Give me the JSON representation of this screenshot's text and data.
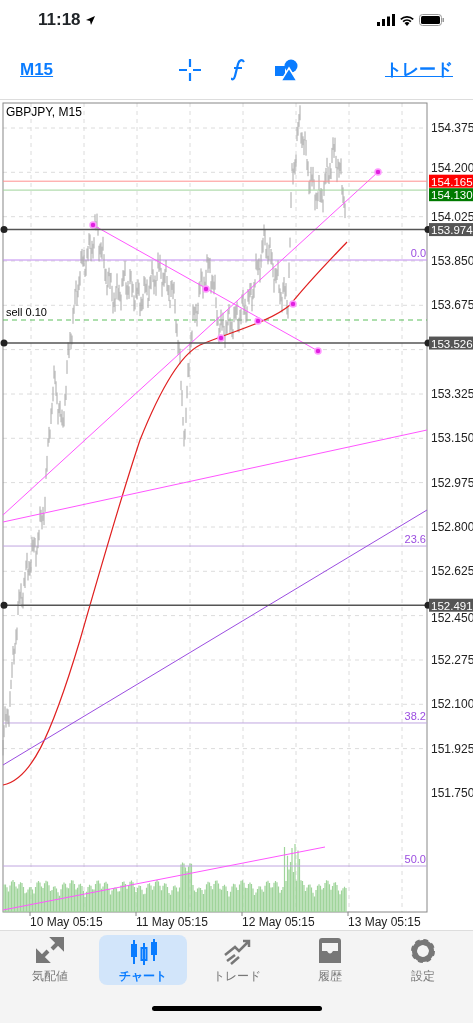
{
  "status_bar": {
    "time": "11:18"
  },
  "toolbar": {
    "timeframe": "M15",
    "trade_link": "トレード"
  },
  "chart": {
    "title": "GBPJPY, M15",
    "price_axis": [
      "154.375",
      "154.200",
      "154.025",
      "153.850",
      "153.675",
      "153.325",
      "153.150",
      "152.975",
      "152.800",
      "152.625",
      "152.450",
      "152.275",
      "152.100",
      "151.925",
      "151.750"
    ],
    "time_axis": [
      "10 May 05:15",
      "11 May 05:15",
      "12 May 05:15",
      "13 May 05:15"
    ],
    "price_tags": [
      {
        "price": "154.165",
        "kind": "ask",
        "color": "#ff0000"
      },
      {
        "price": "154.130",
        "kind": "bid",
        "color": "#007a00"
      },
      {
        "price": "153.974",
        "kind": "hline",
        "color": "#555555"
      },
      {
        "price": "153.526",
        "kind": "hline",
        "color": "#555555"
      },
      {
        "price": "152.491",
        "kind": "hline",
        "color": "#555555"
      }
    ],
    "order": {
      "label": "sell 0.10"
    },
    "fib_levels": [
      {
        "label": "0.0"
      },
      {
        "label": "23.6"
      },
      {
        "label": "38.2"
      },
      {
        "label": "50.0"
      }
    ]
  },
  "tabs": [
    {
      "label": "気配値",
      "selected": false
    },
    {
      "label": "チャート",
      "selected": true
    },
    {
      "label": "トレード",
      "selected": false
    },
    {
      "label": "履歴",
      "selected": false
    },
    {
      "label": "設定",
      "selected": false
    }
  ]
}
